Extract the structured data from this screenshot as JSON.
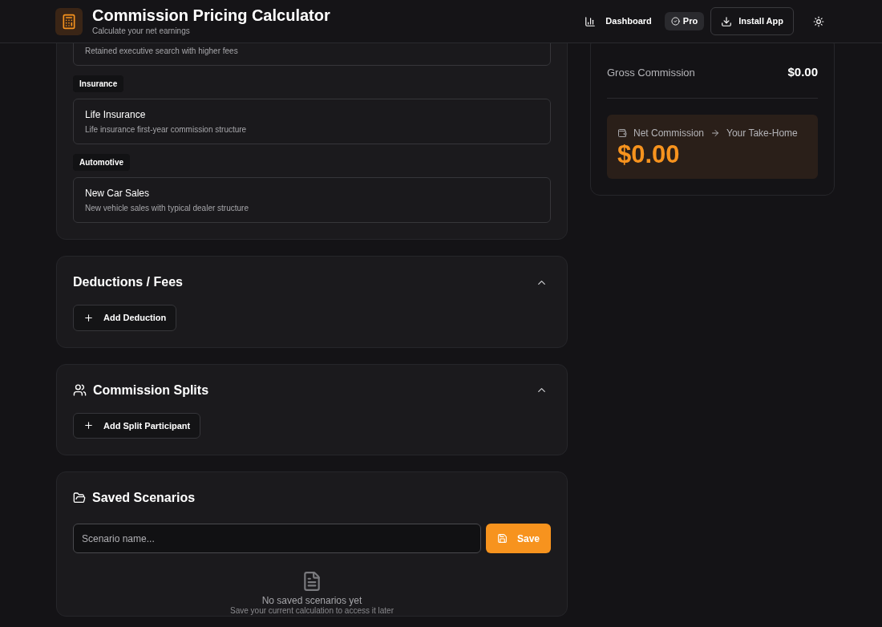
{
  "header": {
    "title": "Commission Pricing Calculator",
    "subtitle": "Calculate your net earnings",
    "nav": [
      {
        "kind": "dashboard",
        "label": "Dashboard"
      },
      {
        "kind": "pro",
        "label": "Pro"
      },
      {
        "kind": "install",
        "label": "Install App"
      },
      {
        "kind": "theme"
      }
    ]
  },
  "presets": {
    "items": [
      {
        "kind": "item",
        "description": "Retained executive search with higher fees"
      },
      {
        "kind": "category",
        "label": "Insurance"
      },
      {
        "kind": "item",
        "title": "Life Insurance",
        "description": "Life insurance first-year commission structure"
      },
      {
        "kind": "category",
        "label": "Automotive"
      },
      {
        "kind": "item",
        "title": "New Car Sales",
        "description": "New vehicle sales with typical dealer structure"
      }
    ]
  },
  "deductions": {
    "title": "Deductions / Fees",
    "expanded": true,
    "button": "Add Deduction"
  },
  "splits": {
    "title": "Commission Splits",
    "expanded": true,
    "button": "Add Split Participant"
  },
  "saved": {
    "title": "Saved Scenarios",
    "placeholder": "Scenario name...",
    "save": "Save",
    "empty_title": "No saved scenarios yet",
    "empty_text": "Save your current calculation to access it later"
  },
  "summary": {
    "gross_label": "Gross Commission",
    "gross_value": "$0.00",
    "net_label": "Net Commission",
    "net_sub": "Your Take-Home",
    "net_value": "$0.00"
  }
}
